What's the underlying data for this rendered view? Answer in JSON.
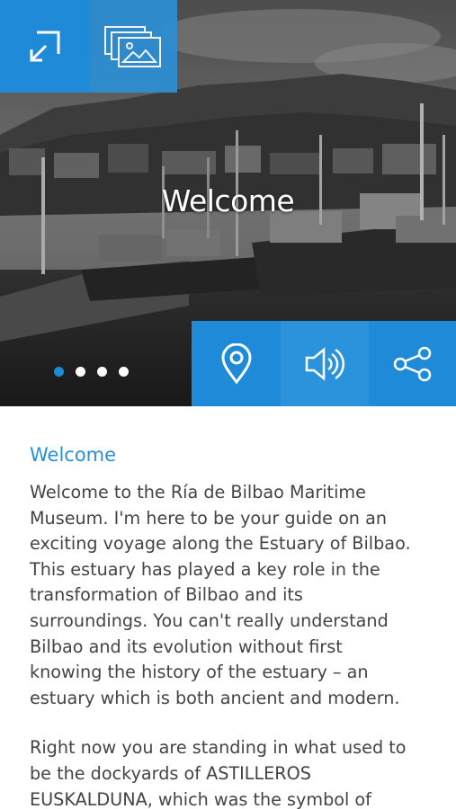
{
  "hero": {
    "title": "Welcome",
    "slides": {
      "count": 4,
      "active_index": 0
    },
    "buttons": {
      "expand_icon": "expand-icon",
      "gallery_icon": "gallery-icon",
      "map_icon": "map-pin-icon",
      "audio_icon": "speaker-icon",
      "share_icon": "share-icon"
    }
  },
  "article": {
    "heading": "Welcome",
    "paragraphs": [
      "Welcome to the Ría de Bilbao Maritime\nMuseum. I'm here to be your guide on an\nexciting voyage along the Estuary of Bilbao.\nThis estuary has played a key role in the\ntransformation of Bilbao and its\nsurroundings. You can't really understand\nBilbao and its evolution without first\nknowing the history of the estuary – an\nestuary which is both ancient and modern.",
      "Right now you are standing in what used to\nbe the dockyards of ASTILLEROS\nEUSKALDUNA, which was the symbol of"
    ]
  },
  "colors": {
    "accent": "#1f8ad8",
    "heading": "#2a8fd8",
    "body_text": "#444444",
    "background": "#ffffff"
  }
}
